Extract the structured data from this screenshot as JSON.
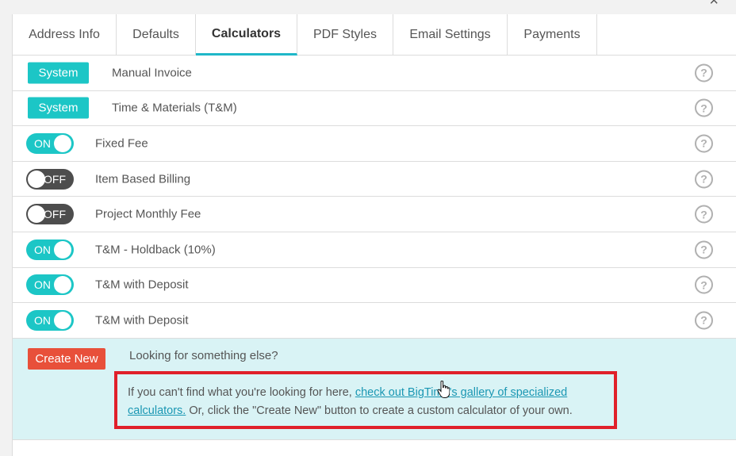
{
  "window": {
    "close_glyph": "×"
  },
  "tabs": [
    {
      "label": "Address Info",
      "active": false
    },
    {
      "label": "Defaults",
      "active": false
    },
    {
      "label": "Calculators",
      "active": true
    },
    {
      "label": "PDF Styles",
      "active": false
    },
    {
      "label": "Email Settings",
      "active": false
    },
    {
      "label": "Payments",
      "active": false
    }
  ],
  "calculators": [
    {
      "type": "system",
      "badge": "System",
      "label": "Manual Invoice",
      "help": "?"
    },
    {
      "type": "system",
      "badge": "System",
      "label": "Time & Materials (T&M)",
      "help": "?"
    },
    {
      "type": "toggle",
      "state": "ON",
      "label": "Fixed Fee",
      "help": "?"
    },
    {
      "type": "toggle",
      "state": "OFF",
      "label": "Item Based Billing",
      "help": "?"
    },
    {
      "type": "toggle",
      "state": "OFF",
      "label": "Project Monthly Fee",
      "help": "?"
    },
    {
      "type": "toggle",
      "state": "ON",
      "label": "T&M - Holdback (10%)",
      "help": "?"
    },
    {
      "type": "toggle",
      "state": "ON",
      "label": "T&M with Deposit",
      "help": "?"
    },
    {
      "type": "toggle",
      "state": "ON",
      "label": "T&M with Deposit",
      "help": "?"
    }
  ],
  "create": {
    "button_label": "Create New",
    "heading": "Looking for something else?",
    "info_prefix": "If you can't find what you're looking for here, ",
    "info_link": "check out BigTime's gallery of specialized calculators.",
    "info_suffix": " Or, click the \"Create New\" button to create a custom calculator of your own."
  },
  "colors": {
    "accent_teal": "#1cc6c6",
    "toggle_off": "#4d4d4d",
    "create_red": "#e8503a",
    "highlight_border": "#e0202a",
    "info_bg": "#d9f3f5",
    "link": "#1a97b3"
  },
  "icons": [
    "close-icon",
    "help-icon",
    "hand-cursor-icon"
  ]
}
